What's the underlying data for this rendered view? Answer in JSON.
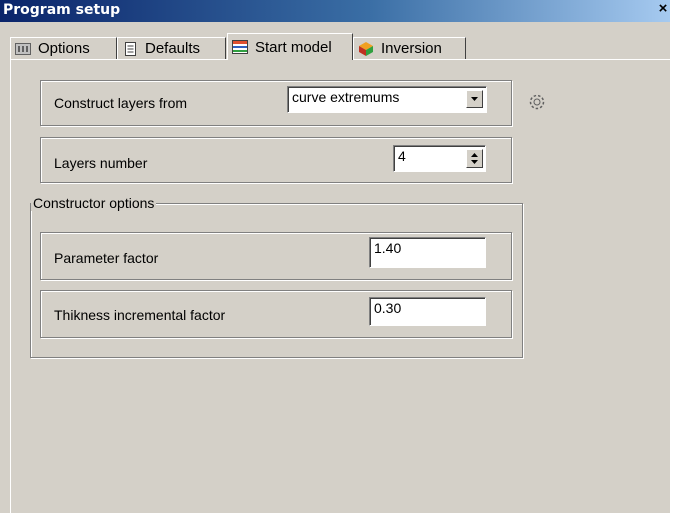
{
  "window": {
    "title": "Program setup",
    "close_symbol": "×"
  },
  "tabs": [
    {
      "label": "Options",
      "icon": "options-icon"
    },
    {
      "label": "Defaults",
      "icon": "document-icon"
    },
    {
      "label": "Start model",
      "icon": "layers-icon",
      "active": true
    },
    {
      "label": "Inversion",
      "icon": "cube-icon"
    }
  ],
  "construct": {
    "label": "Construct layers from",
    "value": "curve extremums"
  },
  "layers": {
    "label": "Layers number",
    "value": "4"
  },
  "constructor_options": {
    "title": "Constructor options",
    "parameter_factor": {
      "label": "Parameter factor",
      "value": "1.40"
    },
    "thickness_factor": {
      "label": "Thikness incremental factor",
      "value": "0.30"
    }
  }
}
